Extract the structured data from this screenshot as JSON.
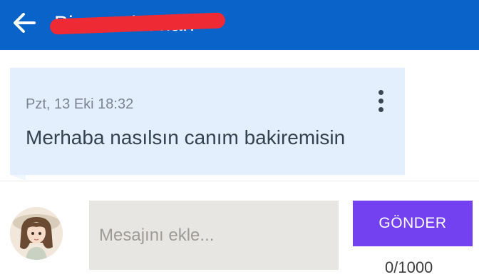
{
  "colors": {
    "brand": "#0a63c9",
    "accent": "#7341ef"
  },
  "header": {
    "back_icon": "arrow-left-icon",
    "title": "Binazenistman"
  },
  "message": {
    "timestamp": "Pzt, 13 Eki 18:32",
    "text": "Merhaba nasılsın canım bakiremisin",
    "menu_icon": "more-vert-icon"
  },
  "composer": {
    "avatar_icon": "user-avatar",
    "input_value": "",
    "input_placeholder": "Mesajını ekle...",
    "send_label": "GÖNDER",
    "char_counter": "0/1000"
  }
}
